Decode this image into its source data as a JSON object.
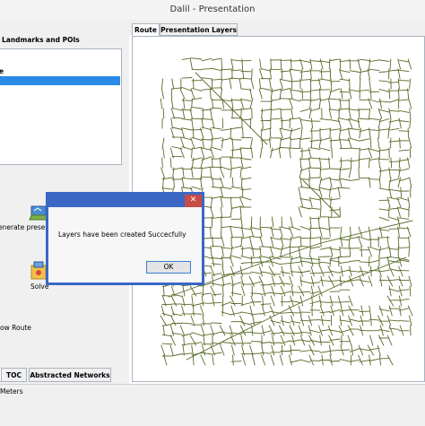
{
  "window": {
    "title": "Dalil - Presentation"
  },
  "left_panel": {
    "landmarks_label": "Landmarks and POIs",
    "list_items": [
      "e",
      ""
    ],
    "actions": [
      {
        "label": "enerate presen",
        "icon": "generate-presentation-icon"
      },
      {
        "label": "Solve",
        "icon": "solve-icon"
      },
      {
        "label": "ow Route",
        "icon": ""
      }
    ]
  },
  "bottom_tabs": [
    "",
    "TOC",
    "Abstracted Networks"
  ],
  "status_bar": {
    "text": "Meters"
  },
  "tabs": [
    {
      "label": "Route",
      "active": true
    },
    {
      "label": "Presentation Layers",
      "active": false
    }
  ],
  "map": {
    "road_color": "#5a6b2a",
    "background": "#ffffff"
  },
  "dialog": {
    "message": "Layers have been created Succecfully",
    "ok_label": "OK",
    "close_glyph": "✕",
    "accent_color": "#3a67c4"
  }
}
